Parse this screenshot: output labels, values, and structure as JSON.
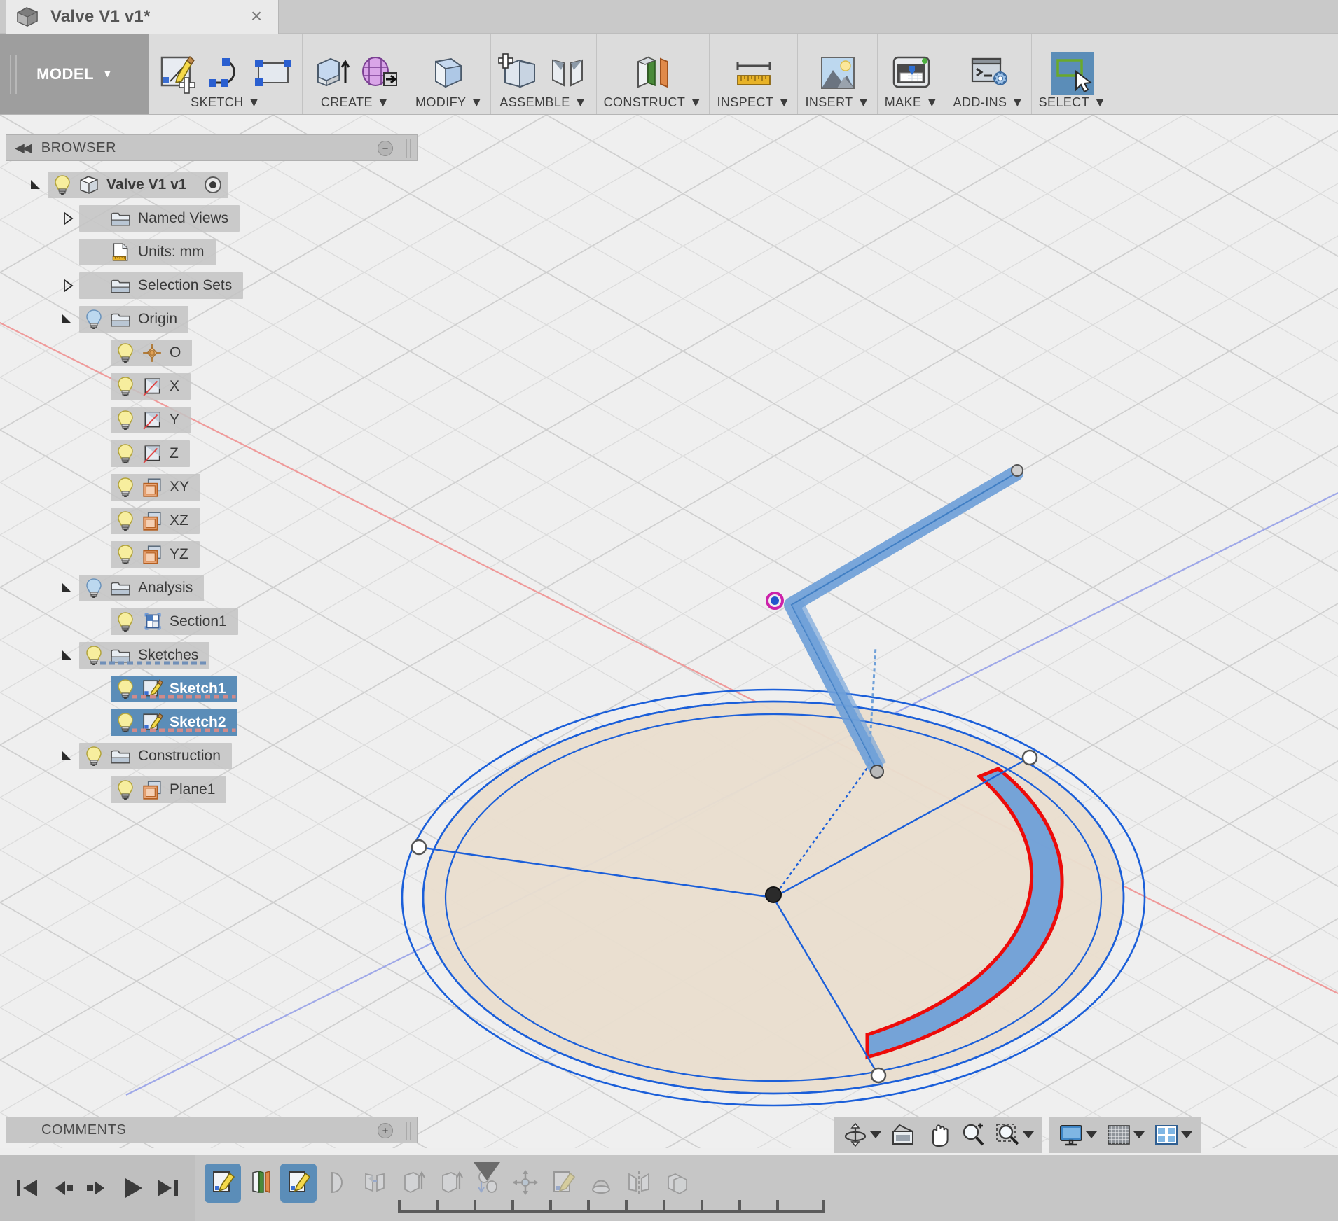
{
  "window": {
    "tab_title": "Valve V1 v1*",
    "close_label": "×",
    "doc_icon": "cube-icon"
  },
  "ribbon": {
    "workspace": {
      "label": "MODEL",
      "caret": "▼"
    },
    "panels": [
      {
        "name": "sketch",
        "label": "SKETCH",
        "caret": "▼",
        "icons": [
          "create-sketch-icon",
          "spline-icon",
          "rectangle-icon"
        ]
      },
      {
        "name": "create",
        "label": "CREATE",
        "caret": "▼",
        "icons": [
          "extrude-icon",
          "revolve-icon"
        ]
      },
      {
        "name": "modify",
        "label": "MODIFY",
        "caret": "▼",
        "icons": [
          "press-pull-icon"
        ]
      },
      {
        "name": "assemble",
        "label": "ASSEMBLE",
        "caret": "▼",
        "icons": [
          "new-component-icon",
          "joint-icon"
        ]
      },
      {
        "name": "construct",
        "label": "CONSTRUCT",
        "caret": "▼",
        "icons": [
          "offset-plane-icon"
        ]
      },
      {
        "name": "inspect",
        "label": "INSPECT",
        "caret": "▼",
        "icons": [
          "measure-icon"
        ]
      },
      {
        "name": "insert",
        "label": "INSERT",
        "caret": "▼",
        "icons": [
          "insert-image-icon"
        ]
      },
      {
        "name": "make",
        "label": "MAKE",
        "caret": "▼",
        "icons": [
          "3d-print-icon"
        ]
      },
      {
        "name": "add-ins",
        "label": "ADD-INS",
        "caret": "▼",
        "icons": [
          "scripts-addins-icon"
        ]
      },
      {
        "name": "select",
        "label": "SELECT",
        "caret": "▼",
        "icons": [
          "select-window-icon"
        ],
        "active": true
      }
    ]
  },
  "browser": {
    "header_title": "BROWSER",
    "collapse_glyph": "◀◀",
    "minimize_glyph": "−",
    "tree": [
      {
        "label": "Valve V1 v1",
        "indent": 0,
        "twisty": "expanded",
        "bulb": "on",
        "icon": "component-icon",
        "selected": false,
        "root": true,
        "bold": true,
        "radio": true
      },
      {
        "label": "Named Views",
        "indent": 1,
        "twisty": "collapsed",
        "bulb": "none",
        "icon": "folder-icon",
        "selected": false
      },
      {
        "label": "Units: mm",
        "indent": 1,
        "twisty": "none",
        "bulb": "none",
        "icon": "units-icon",
        "selected": false
      },
      {
        "label": "Selection Sets",
        "indent": 1,
        "twisty": "collapsed",
        "bulb": "none",
        "icon": "folder-icon",
        "selected": false
      },
      {
        "label": "Origin",
        "indent": 1,
        "twisty": "expanded",
        "bulb": "blue",
        "icon": "folder-icon",
        "selected": false
      },
      {
        "label": "O",
        "indent": 2,
        "twisty": "none",
        "bulb": "on",
        "icon": "origin-point-icon",
        "selected": false
      },
      {
        "label": "X",
        "indent": 2,
        "twisty": "none",
        "bulb": "on",
        "icon": "axis-icon",
        "selected": false
      },
      {
        "label": "Y",
        "indent": 2,
        "twisty": "none",
        "bulb": "on",
        "icon": "axis-icon",
        "selected": false
      },
      {
        "label": "Z",
        "indent": 2,
        "twisty": "none",
        "bulb": "on",
        "icon": "axis-icon",
        "selected": false
      },
      {
        "label": "XY",
        "indent": 2,
        "twisty": "none",
        "bulb": "on",
        "icon": "plane-icon",
        "selected": false
      },
      {
        "label": "XZ",
        "indent": 2,
        "twisty": "none",
        "bulb": "on",
        "icon": "plane-icon",
        "selected": false
      },
      {
        "label": "YZ",
        "indent": 2,
        "twisty": "none",
        "bulb": "on",
        "icon": "plane-icon",
        "selected": false
      },
      {
        "label": "Analysis",
        "indent": 1,
        "twisty": "expanded",
        "bulb": "blue",
        "icon": "folder-icon",
        "selected": false
      },
      {
        "label": "Section1",
        "indent": 2,
        "twisty": "none",
        "bulb": "on",
        "icon": "section-icon",
        "selected": false
      },
      {
        "label": "Sketches",
        "indent": 1,
        "twisty": "expanded",
        "bulb": "on",
        "icon": "folder-icon",
        "selected": false,
        "dashed": true
      },
      {
        "label": "Sketch1",
        "indent": 2,
        "twisty": "none",
        "bulb": "on",
        "icon": "sketch-icon",
        "selected": true,
        "dashed": true
      },
      {
        "label": "Sketch2",
        "indent": 2,
        "twisty": "none",
        "bulb": "on",
        "icon": "sketch-icon",
        "selected": true,
        "dashed": true
      },
      {
        "label": "Construction",
        "indent": 1,
        "twisty": "expanded",
        "bulb": "on",
        "icon": "folder-icon",
        "selected": false
      },
      {
        "label": "Plane1",
        "indent": 2,
        "twisty": "none",
        "bulb": "on",
        "icon": "plane-icon",
        "selected": false
      }
    ]
  },
  "comments": {
    "header_title": "COMMENTS",
    "add_glyph": "+"
  },
  "navbar": {
    "groups": [
      {
        "name": "view-tools",
        "items": [
          {
            "name": "orbit-icon",
            "caret": "▼"
          },
          {
            "name": "look-at-icon",
            "caret": ""
          },
          {
            "name": "pan-icon",
            "caret": ""
          },
          {
            "name": "zoom-icon",
            "caret": ""
          },
          {
            "name": "zoom-window-icon",
            "caret": "▼"
          }
        ]
      },
      {
        "name": "display-tools",
        "items": [
          {
            "name": "display-settings-icon",
            "caret": "▼"
          },
          {
            "name": "grid-snaps-icon",
            "caret": "▼"
          },
          {
            "name": "viewports-icon",
            "caret": "▼"
          }
        ]
      }
    ]
  },
  "timeline": {
    "playback": [
      {
        "name": "go-to-beginning-button",
        "glyph": "first"
      },
      {
        "name": "step-back-button",
        "glyph": "prev"
      },
      {
        "name": "step-forward-button",
        "glyph": "next"
      },
      {
        "name": "play-button",
        "glyph": "play"
      },
      {
        "name": "go-to-end-button",
        "glyph": "last"
      }
    ],
    "features": [
      {
        "name": "sketch1-feature",
        "icon": "sketch-icon",
        "active": true
      },
      {
        "name": "construction-plane-feature",
        "icon": "plane-icon",
        "active": false
      },
      {
        "name": "sketch2-feature",
        "icon": "sketch-icon",
        "active": true
      },
      {
        "name": "revolve-feature",
        "icon": "revolve-icon",
        "active": false,
        "dim": true
      },
      {
        "name": "joint-feature",
        "icon": "joint-icon",
        "active": false,
        "dim": true
      },
      {
        "name": "extrude-feature",
        "icon": "extrude-icon",
        "active": false,
        "dim": true
      },
      {
        "name": "extrude2-feature",
        "icon": "extrude-icon",
        "active": false,
        "dim": true
      },
      {
        "name": "rigid-group-feature",
        "icon": "rigid-group-icon",
        "active": false,
        "dim": true
      },
      {
        "name": "move-feature",
        "icon": "move-icon",
        "active": false,
        "dim": true
      },
      {
        "name": "sketch3-feature",
        "icon": "sketch-icon",
        "active": false,
        "dim": true
      },
      {
        "name": "sweep-feature",
        "icon": "sweep-icon",
        "active": false,
        "dim": true
      },
      {
        "name": "mirror-feature",
        "icon": "mirror-icon",
        "active": false,
        "dim": true
      },
      {
        "name": "pattern-feature",
        "icon": "pattern-icon",
        "active": false,
        "dim": true
      }
    ]
  },
  "canvas": {
    "description": "3D CAD viewport showing a circular sketch disk with an arc segment highlighted and a bent line sketch above",
    "colors": {
      "sketch_blue": "#1b5fd9",
      "selection_blue": "#5b8db8",
      "highlight_red": "#ee0000",
      "face_tan": "#eadfcf",
      "x_axis_red": "#e87c7c",
      "y_axis_blue": "#8e8ee0",
      "background": "#efefef",
      "grid_line": "#d8d8d8"
    }
  }
}
